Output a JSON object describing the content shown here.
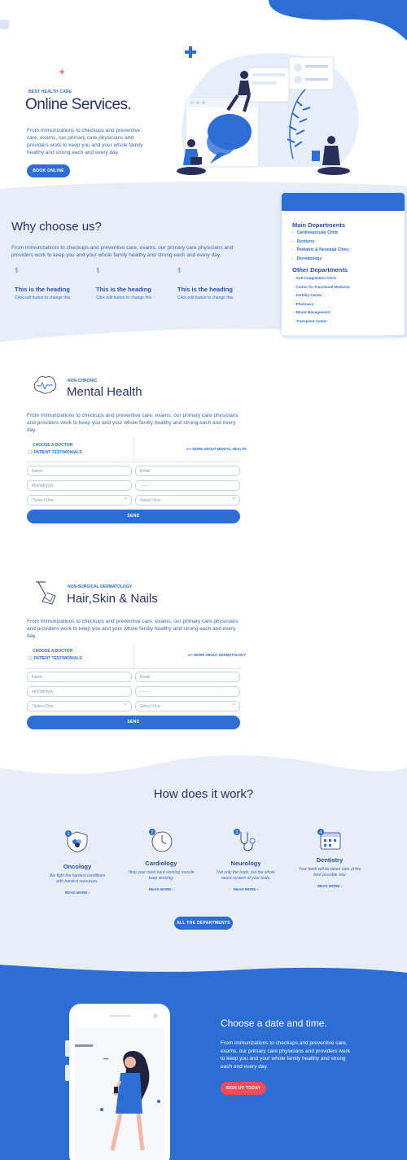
{
  "hero": {
    "eyebrow": "BEST HEALTH CARE",
    "title": "Online Services.",
    "text": "From immunizations to checkups and  preventive care,  exams, our primary care physicians and providers work to keep you and your whole family healthy and strong each and every day.",
    "button": "BOOK ONLINE"
  },
  "why": {
    "title": "Why choose us?",
    "text": "From immunizations to checkups and  preventive care,  exams, our primary care physicians and providers work to keep you and your whole family healthy and strong each and every day.",
    "features": [
      {
        "heading": "This is the heading",
        "sub": "Click edit button to change this"
      },
      {
        "heading": "This is the heading",
        "sub": "Click edit button to change this"
      },
      {
        "heading": "This is the heading",
        "sub": "Click edit button to change this"
      }
    ]
  },
  "departments": {
    "main_title": "Main Departments",
    "main": [
      "Cardiovascular Clinic",
      "Dentistry",
      "Pediatric & Neonatal Clinic",
      "Dermatology"
    ],
    "other_title": "Other Departments",
    "other": [
      "Anti-Coagulation Clinic",
      "Center for Functional Medicine",
      "Fertility Center",
      "Pharmacy",
      "Blood Management",
      "Transplant Center"
    ]
  },
  "mental": {
    "eyebrow": "NON-CHRONIC",
    "title": "Mental Health",
    "text": "From immunizations to checkups and  preventive care,  exams, our primary care physicians and providers work to keep you and your whole family healthy and strong each and every day.",
    "choose": "CHOOSE A DOCTOR",
    "testimonials": "PATIENT TESTIMONIALS",
    "more": "MORE ABOUT MENTAL HEALTH",
    "form": {
      "name": "Name",
      "email": "Email",
      "date": "mm/dd/yyyy",
      "time": "--:-- --",
      "select1": "*Select One -",
      "select2": "Select One -",
      "send": "SEND"
    }
  },
  "derma": {
    "eyebrow": "NON-SURGICAL DERMATOLOGY",
    "title": "Hair,Skin & Nails",
    "text": "From immunizations to checkups and  preventive care,  exams, our primary care physicians and providers work to keep you and your whole family healthy and strong each and every day.",
    "choose": "CHOOSE A DOCTOR",
    "testimonials": "PATIENT TESTIMONIALS",
    "more": "MORE ABOUT DERMATOLOGY",
    "form": {
      "name": "Name",
      "email": "Email",
      "date": "mm/dd/yyyy",
      "time": "--:-- --",
      "select1": "*Select One -",
      "select2": "Select One -",
      "send": "SEND"
    }
  },
  "how": {
    "title": "How does it work?",
    "steps": [
      {
        "num": "1",
        "title": "Oncology",
        "text": "We fight the hardest conditions with hardest resources.",
        "link": "READ MORE",
        "icon": "shield-icon"
      },
      {
        "num": "2",
        "title": "Cardiology",
        "text": "Help your most hard working muscle keep working.",
        "link": "READ MORE",
        "icon": "clock-icon"
      },
      {
        "num": "3",
        "title": "Neurology",
        "text": "Not only the brain, but the whole neura-system of your body.",
        "link": "READ MORE",
        "icon": "stethoscope-icon"
      },
      {
        "num": "4",
        "title": "Dentistry",
        "text": "Your teeth will be taken care of the best possible way",
        "link": "READ MORE",
        "icon": "calendar-icon"
      }
    ],
    "button": "ALL THE DEPARTMENTS"
  },
  "appointment": {
    "title": "Choose a date and time.",
    "text": "From immunizations to checkups and  preventive care, exams, our primary care physicians and providers work to keep you and your whole family healthy and strong each and every day.",
    "button": "SIGN UP TODAY"
  },
  "colors": {
    "primary": "#2d6ed4",
    "navy": "#28306b",
    "light": "#e8eef8",
    "accent": "#f24a5f"
  }
}
